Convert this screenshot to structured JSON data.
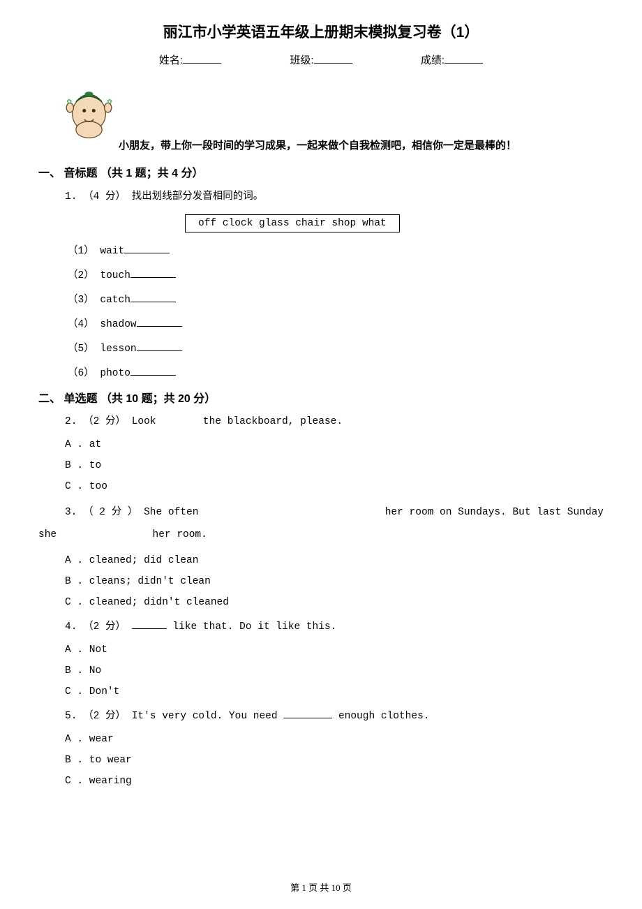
{
  "title": "丽江市小学英语五年级上册期末模拟复习卷（1）",
  "info": {
    "name_label": "姓名:",
    "class_label": "班级:",
    "score_label": "成绩:"
  },
  "encouragement": "小朋友，带上你一段时间的学习成果，一起来做个自我检测吧，相信你一定是最棒的！",
  "section1": {
    "title": "一、 音标题 （共 1 题；共 4 分）",
    "q1": {
      "num": "1. （4 分） 找出划线部分发音相同的词。",
      "box": "off   clock   glass   chair   shop   what",
      "items": [
        "（1） wait",
        "（2） touch",
        "（3） catch",
        "（4） shadow",
        "（5） lesson",
        "（6） photo"
      ]
    }
  },
  "section2": {
    "title": "二、 单选题 （共 10 题；共 20 分）",
    "q2": {
      "text_pre": "2. （2 分） Look ",
      "text_post": " the blackboard, please.",
      "opts": {
        "A": "A . at",
        "B": "B . to",
        "C": "C . too"
      }
    },
    "q3": {
      "pre": "3.  （ 2 分 ）   She  often ",
      "mid": " her  room  on  Sundays.  But  last  Sunday",
      "line2_pre": "she ",
      "line2_post": " her room.",
      "opts": {
        "A": "A . cleaned; did clean",
        "B": "B . cleans; didn't clean",
        "C": "C . cleaned; didn't cleaned"
      }
    },
    "q4": {
      "text_pre": "4. （2 分） ",
      "text_post": " like that. Do it like this.",
      "opts": {
        "A": "A . Not",
        "B": "B . No",
        "C": "C . Don't"
      }
    },
    "q5": {
      "text_pre": "5. （2 分） It's very cold. You need ",
      "text_post": " enough clothes.",
      "opts": {
        "A": "A . wear",
        "B": "B . to wear",
        "C": "C . wearing"
      }
    }
  },
  "footer": "第 1 页 共 10 页"
}
